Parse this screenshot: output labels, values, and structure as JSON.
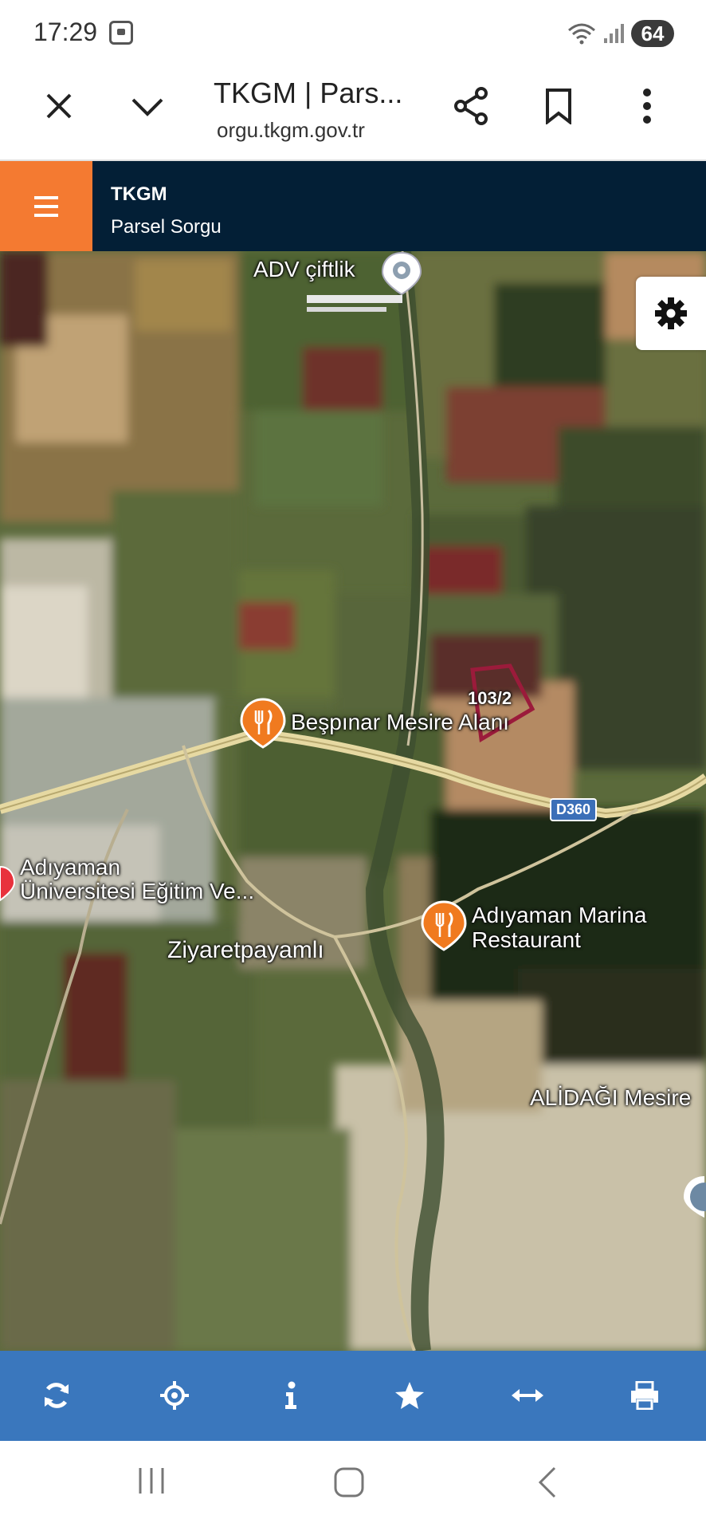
{
  "status_bar": {
    "time": "17:29",
    "battery": "64",
    "icons": [
      "screenshot-icon",
      "wifi-icon",
      "cell-signal-icon",
      "battery-icon"
    ]
  },
  "browser": {
    "title": "TKGM | Pars...",
    "url": "orgu.tkgm.gov.tr",
    "icons": [
      "close-icon",
      "chevron-down-icon",
      "share-icon",
      "bookmark-icon",
      "more-vert-icon"
    ]
  },
  "app": {
    "brand": "TKGM",
    "subtitle": "Parsel Sorgu",
    "menu_icon": "hamburger-icon",
    "accent_color": "#f47a31",
    "header_color": "#031f36"
  },
  "map": {
    "settings_icon": "gear-icon",
    "parcel": {
      "label": "103/2",
      "color": "#9b1b3b"
    },
    "places": {
      "adv": "ADV çiftlik",
      "bespinar": "Beşpınar Mesire Alanı",
      "road": "D360",
      "university_line1": "Adıyaman",
      "university_line2": "Üniversitesi Eğitim Ve...",
      "ziyaret": "Ziyaretpayamlı",
      "marina_line1": "Adıyaman Marina",
      "marina_line2": "Restaurant",
      "alidagi": "ALİDAĞI Mesire"
    }
  },
  "bottom_toolbar": {
    "color": "#3a77bd",
    "buttons": [
      "refresh-icon",
      "locate-icon",
      "info-icon",
      "star-icon",
      "measure-icon",
      "print-icon"
    ]
  },
  "nav_bar": {
    "buttons": [
      "recent-apps-icon",
      "home-icon",
      "back-icon"
    ]
  }
}
